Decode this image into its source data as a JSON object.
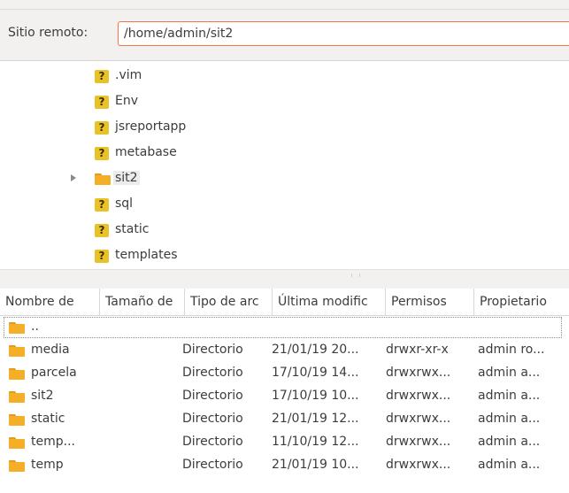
{
  "remote_site": {
    "label": "Sitio remoto:",
    "path": "/home/admin/sit2"
  },
  "tree": {
    "items": [
      {
        "label": ".vim",
        "icon": "question-icon",
        "expandable": false,
        "selected": false
      },
      {
        "label": "Env",
        "icon": "question-icon",
        "expandable": false,
        "selected": false
      },
      {
        "label": "jsreportapp",
        "icon": "question-icon",
        "expandable": false,
        "selected": false
      },
      {
        "label": "metabase",
        "icon": "question-icon",
        "expandable": false,
        "selected": false
      },
      {
        "label": "sit2",
        "icon": "folder-icon",
        "expandable": true,
        "selected": true
      },
      {
        "label": "sql",
        "icon": "question-icon",
        "expandable": false,
        "selected": false
      },
      {
        "label": "static",
        "icon": "question-icon",
        "expandable": false,
        "selected": false
      },
      {
        "label": "templates",
        "icon": "question-icon",
        "expandable": false,
        "selected": false
      }
    ]
  },
  "file_list": {
    "columns": [
      "Nombre de",
      "Tamaño de",
      "Tipo de arc",
      "Última modific",
      "Permisos",
      "Propietario"
    ],
    "rows": [
      {
        "name": "..",
        "size": "",
        "type": "",
        "modified": "",
        "permissions": "",
        "owner": ""
      },
      {
        "name": "media",
        "size": "",
        "type": "Directorio",
        "modified": "21/01/19 20...",
        "permissions": "drwxr-xr-x",
        "owner": "admin ro..."
      },
      {
        "name": "parcela",
        "size": "",
        "type": "Directorio",
        "modified": "17/10/19 14...",
        "permissions": "drwxrwx...",
        "owner": "admin a..."
      },
      {
        "name": "sit2",
        "size": "",
        "type": "Directorio",
        "modified": "17/10/19 10...",
        "permissions": "drwxrwx...",
        "owner": "admin a..."
      },
      {
        "name": "static",
        "size": "",
        "type": "Directorio",
        "modified": "21/01/19 12...",
        "permissions": "drwxrwx...",
        "owner": "admin a..."
      },
      {
        "name": "temp...",
        "size": "",
        "type": "Directorio",
        "modified": "11/10/19 12...",
        "permissions": "drwxrwx...",
        "owner": "admin a..."
      },
      {
        "name": "temp",
        "size": "",
        "type": "Directorio",
        "modified": "21/01/19 10...",
        "permissions": "drwxrwx...",
        "owner": "admin a..."
      }
    ]
  },
  "colors": {
    "folder": "#f4ae28",
    "question_icon": "#e8c227",
    "input_focus_border": "#f07746"
  }
}
